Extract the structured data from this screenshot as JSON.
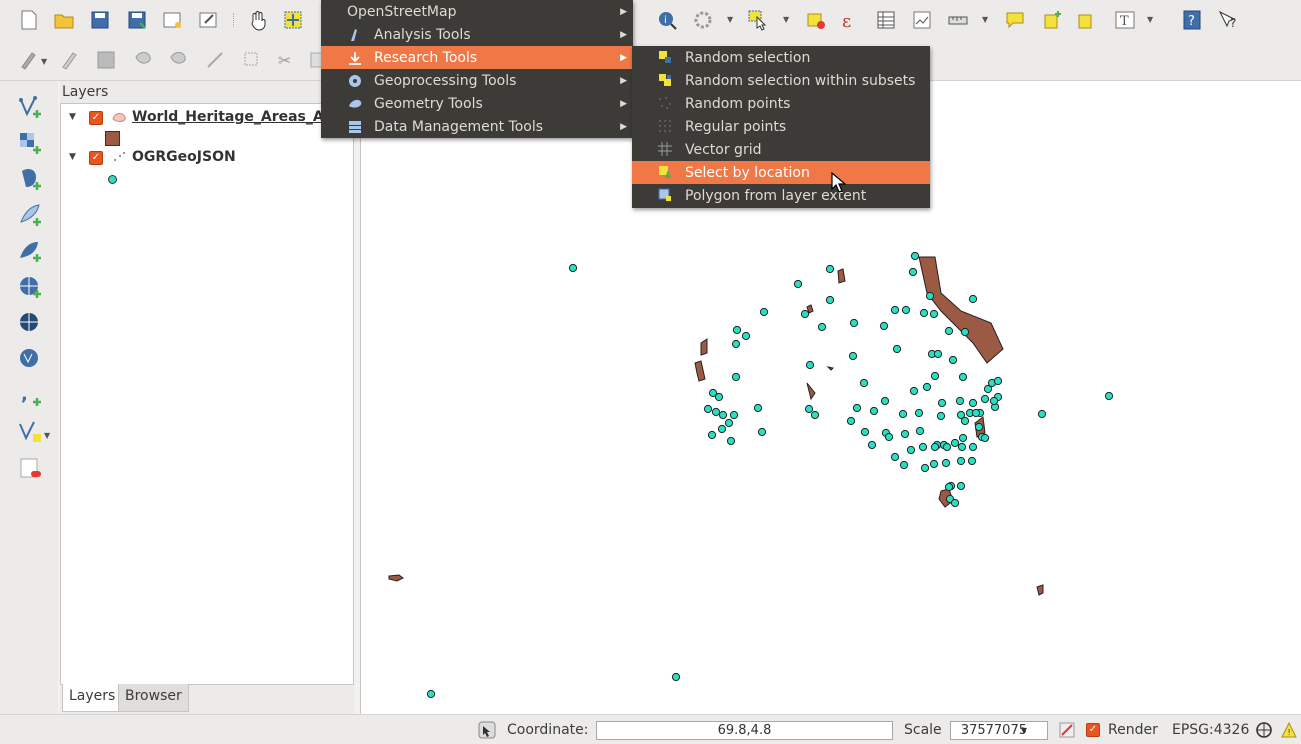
{
  "menu": {
    "main_items": [
      {
        "label": "OpenStreetMap",
        "icon": "none"
      },
      {
        "label": "Analysis Tools",
        "icon": "analysis-icon"
      },
      {
        "label": "Research Tools",
        "icon": "research-icon"
      },
      {
        "label": "Geoprocessing Tools",
        "icon": "geoprocessing-icon"
      },
      {
        "label": "Geometry Tools",
        "icon": "geometry-icon"
      },
      {
        "label": "Data Management Tools",
        "icon": "data-management-icon"
      }
    ],
    "active_main": "Research Tools",
    "sub_items": [
      {
        "label": "Random selection",
        "icon": "random-selection-icon"
      },
      {
        "label": "Random selection within subsets",
        "icon": "random-subset-icon"
      },
      {
        "label": "Random points",
        "icon": "random-points-icon"
      },
      {
        "label": "Regular points",
        "icon": "regular-points-icon"
      },
      {
        "label": "Vector grid",
        "icon": "vector-grid-icon"
      },
      {
        "label": "Select by location",
        "icon": "select-location-icon"
      },
      {
        "label": "Polygon from layer extent",
        "icon": "polygon-extent-icon"
      }
    ],
    "active_sub": "Select by location"
  },
  "layers_panel": {
    "title": "Layers",
    "layers": [
      {
        "name": "World_Heritage_Areas_Aus",
        "checked": true,
        "type": "polygon",
        "symbol_color": "#9c5a45"
      },
      {
        "name": "OGRGeoJSON",
        "checked": true,
        "type": "point",
        "symbol_color": "#27e0c3"
      }
    ],
    "tabs": [
      "Layers",
      "Browser"
    ]
  },
  "statusbar": {
    "coordinate_label": "Coordinate:",
    "coordinate_value": "69.8,4.8",
    "scale_label": "Scale",
    "scale_value": "37577075",
    "render_label": "Render",
    "crs": "EPSG:4326"
  },
  "colors": {
    "menu_bg": "#3c3b37",
    "menu_highlight": "#f07746",
    "polygon_fill": "#9c5a45",
    "point_fill": "#27e0c3"
  }
}
